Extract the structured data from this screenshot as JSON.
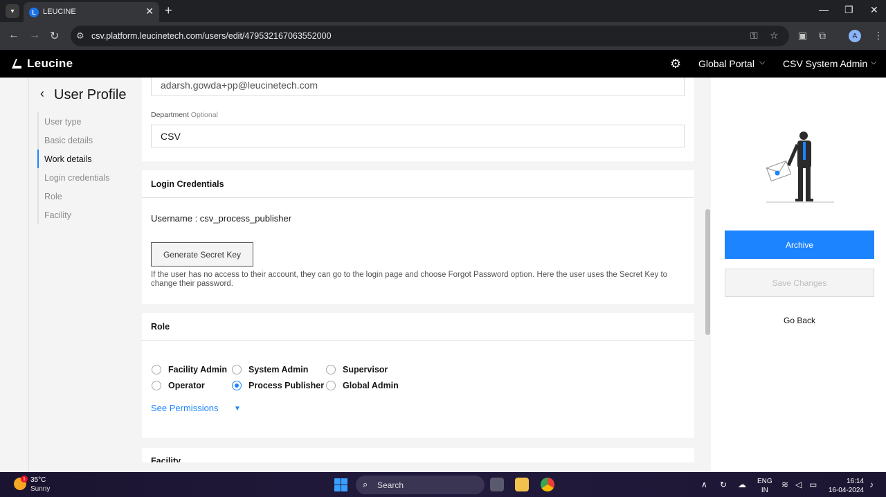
{
  "browser": {
    "tab_title": "LEUCINE",
    "url": "csv.platform.leucinetech.com/users/edit/479532167063552000",
    "profile_initial": "A"
  },
  "header": {
    "logo_text": "Leucine",
    "portal_label": "Global Portal",
    "user_label": "CSV System Admin"
  },
  "leftnav": {
    "title": "User Profile",
    "steps": [
      "User type",
      "Basic details",
      "Work details",
      "Login credentials",
      "Role",
      "Facility"
    ],
    "active_step": "Work details"
  },
  "work_details": {
    "email_partial": "adarsh.gowda+pp@leucinetech.com",
    "department_label": "Department",
    "department_optional": "Optional",
    "department_value": "CSV"
  },
  "login_credentials": {
    "title": "Login Credentials",
    "username_line": "Username : csv_process_publisher",
    "generate_button": "Generate Secret Key",
    "helper_text": "If the user has no access to their account, they can go to the login page and choose Forgot Password option. Here the user uses the Secret Key to change their password."
  },
  "role": {
    "title": "Role",
    "options": [
      "Facility Admin",
      "System Admin",
      "Supervisor",
      "Operator",
      "Process Publisher",
      "Global Admin"
    ],
    "selected": "Process Publisher",
    "see_permissions": "See Permissions"
  },
  "facility": {
    "title": "Facility"
  },
  "actions": {
    "archive": "Archive",
    "save": "Save Changes",
    "go_back": "Go Back"
  },
  "taskbar": {
    "temperature": "35°C",
    "weather": "Sunny",
    "weather_badge": "1",
    "search_placeholder": "Search",
    "lang_line1": "ENG",
    "lang_line2": "IN",
    "time": "16:14",
    "date": "16-04-2024"
  },
  "colors": {
    "accent": "#1d84ff",
    "header_bg": "#000000",
    "page_bg": "#f4f4f4"
  }
}
